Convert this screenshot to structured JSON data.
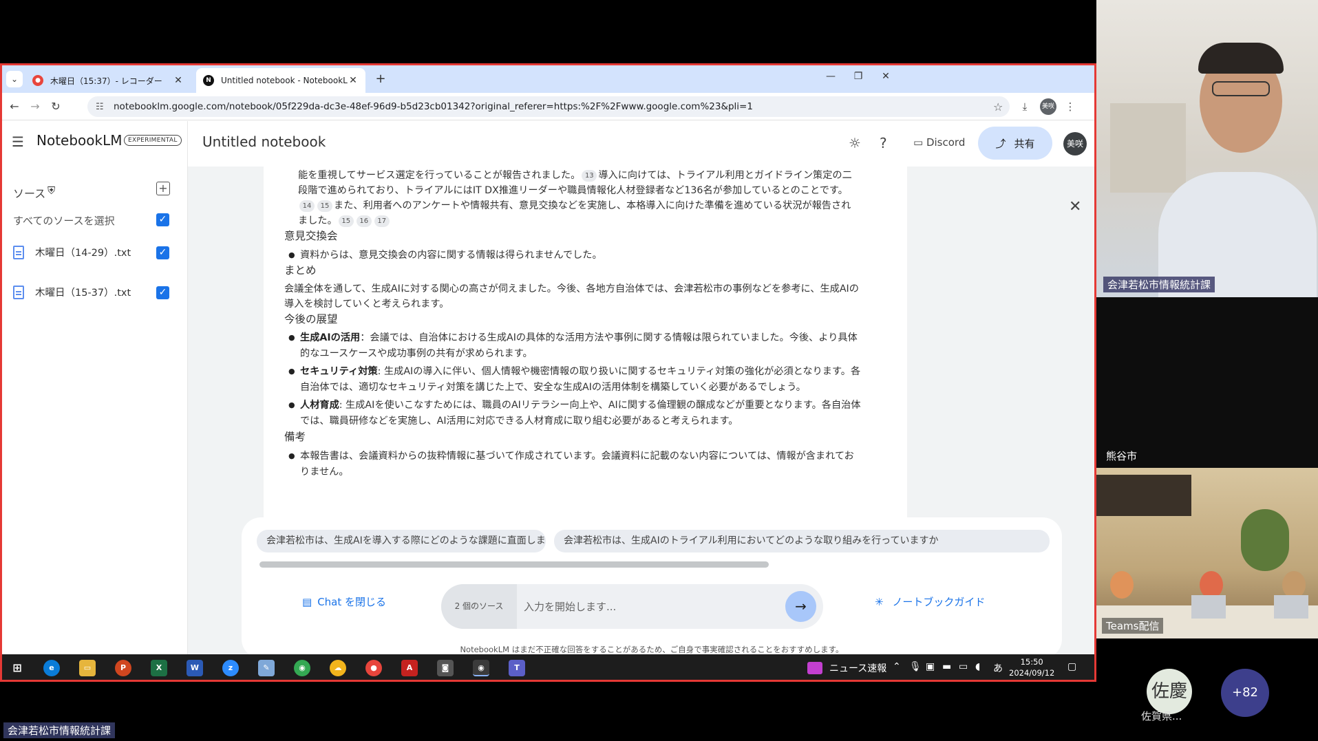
{
  "browser": {
    "tabs": [
      {
        "title": "木曜日（15:37）- レコーダー",
        "active": false,
        "favicon_color": "#e8453c"
      },
      {
        "title": "Untitled notebook - NotebookLM",
        "active": true,
        "favicon_letter": "N",
        "favicon_color": "#111111"
      }
    ],
    "url": "notebooklm.google.com/notebook/05f229da-dc3e-48ef-96d9-b5d23cb01342?original_referer=https:%2F%2Fwww.google.com%23&pli=1",
    "profile_initials": "美咲"
  },
  "app": {
    "brand": "NotebookLM",
    "brand_badge": "EXPERIMENTAL",
    "sidebar": {
      "sources_heading": "ソース",
      "select_all": "すべてのソースを選択",
      "items": [
        {
          "label": "木曜日（14-29）.txt",
          "checked": true
        },
        {
          "label": "木曜日（15-37）.txt",
          "checked": true
        }
      ]
    },
    "header": {
      "title": "Untitled notebook",
      "discord_label": "Discord",
      "share_label": "共有",
      "user_initials": "美咲"
    },
    "report": {
      "para1_l1": "能を重視してサービス選定を行っていることが報告されました。",
      "cite13": "13",
      "para1_l1b": "導入に向けては、トライアル利用とガイドライン策定の二",
      "para1_l2": "段階で進められており、トライアルにはIT DX推進リーダーや職員情報化人材登録者など136名が参加しているとのことです。",
      "cite14": "14",
      "cite15": "15",
      "para1_l3": "また、利用者へのアンケートや情報共有、意見交換などを実施し、本格導入に向けた準備を進めている状況が報告され",
      "para1_l4": "ました。",
      "cite15b": "15",
      "cite16": "16",
      "cite17": "17",
      "h_meeting": "意見交換会",
      "b_meeting": "資料からは、意見交換会の内容に関する情報は得られませんでした。",
      "h_summary": "まとめ",
      "p_summary_l1": "会議全体を通して、生成AIに対する関心の高さが伺えました。今後、各地方自治体では、会津若松市の事例などを参考に、生成AIの",
      "p_summary_l2": "導入を検討していくと考えられます。",
      "h_future": "今後の展望",
      "b1_title": "生成AIの活用",
      "b1_l1": "：会議では、自治体における生成AIの具体的な活用方法や事例に関する情報は限られていました。今後、より具体",
      "b1_l2": "的なユースケースや成功事例の共有が求められます。",
      "b2_title": "セキュリティ対策",
      "b2_l1": ": 生成AIの導入に伴い、個人情報や機密情報の取り扱いに関するセキュリティ対策の強化が必須となります。各",
      "b2_l2": "自治体では、適切なセキュリティ対策を講じた上で、安全な生成AIの活用体制を構築していく必要があるでしょう。",
      "b3_title": "人材育成",
      "b3_l1": ": 生成AIを使いこなすためには、職員のAIリテラシー向上や、AIに関する倫理観の醸成などが重要となります。各自治体",
      "b3_l2": "では、職員研修などを実施し、AI活用に対応できる人材育成に取り組む必要があると考えられます。",
      "h_notes": "備考",
      "b_notes_l1": "本報告書は、会議資料からの抜粋情報に基づいて作成されています。会議資料に記載のない内容については、情報が含まれてお",
      "b_notes_l2": "りません。"
    },
    "chat": {
      "suggestion1": "会津若松市は、生成AIを導入する際にどのような課題に直面しましたか？",
      "suggestion2": "会津若松市は、生成AIのトライアル利用においてどのような取り組みを行っていますか",
      "close_chat": "Chat を閉じる",
      "source_count": "2 個のソース",
      "input_placeholder": "入力を開始します...",
      "guide": "ノートブックガイド",
      "disclaimer": "NotebookLM はまだ不正確な回答をすることがあるため、ご自身で事実確認されることをおすすめします。"
    }
  },
  "taskbar": {
    "news": "ニュース速報",
    "ime": "あ",
    "time": "15:50",
    "date": "2024/09/12"
  },
  "participants": {
    "tile1_name": "会津若松市情報統計課",
    "tile2_name": "熊谷市",
    "tile3_name": "Teams配信",
    "avatar_initials": "佐慶",
    "avatar_name": "佐賀県...",
    "more_count": "+82",
    "presenter_label": "会津若松市情報統計課"
  }
}
